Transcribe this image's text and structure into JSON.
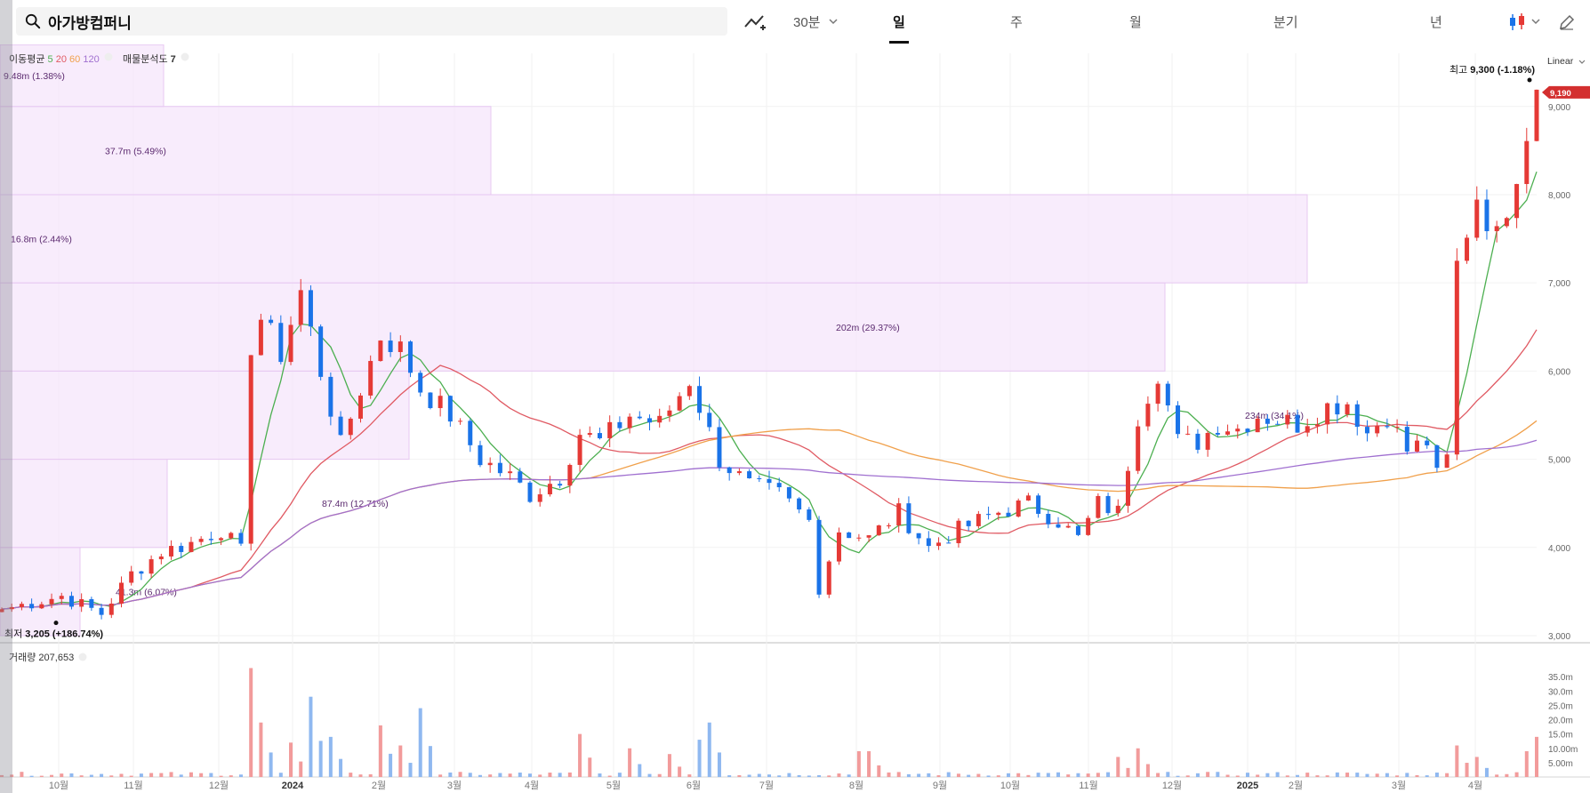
{
  "header": {
    "stock_name": "아가방컴퍼니",
    "interval": "30분",
    "tabs": [
      "일",
      "주",
      "월",
      "분기",
      "년"
    ],
    "active_tab": "일"
  },
  "indicators": {
    "ma_label": "이동평균",
    "ma_periods": [
      "5",
      "20",
      "60",
      "120"
    ],
    "ma_colors": [
      "#4caf50",
      "#e05a63",
      "#f0a04b",
      "#a070d0"
    ],
    "profile_label": "매물분석도",
    "profile_value": "7",
    "scale_label": "Linear",
    "volume_label": "거래량",
    "volume_value": "207,653"
  },
  "chart_data": {
    "type": "candlestick",
    "x_labels": [
      "10월",
      "11월",
      "12월",
      "2024",
      "2월",
      "3월",
      "4월",
      "5월",
      "6월",
      "7월",
      "8월",
      "9월",
      "10월",
      "11월",
      "12월",
      "2025",
      "2월",
      "3월",
      "4월"
    ],
    "price_axis": {
      "ticks": [
        3000,
        4000,
        5000,
        6000,
        7000,
        8000,
        9000
      ],
      "ylim": [
        3000,
        9300
      ]
    },
    "volume_axis": {
      "tick_labels": [
        "5.00m",
        "10.00m",
        "15.0m",
        "20.0m",
        "25.0m",
        "30.0m",
        "35.0m"
      ],
      "ticks": [
        5,
        10,
        15,
        20,
        25,
        30,
        35
      ],
      "ylim": [
        0,
        40
      ]
    },
    "current_price": "9,190",
    "high_annotation": {
      "label": "최고",
      "value": "9,300 (-1.18%)"
    },
    "low_annotation": {
      "label": "최저",
      "value": "3,205 (+186.74%)"
    },
    "volume_profile": [
      {
        "price_low": 3000,
        "price_high": 4000,
        "label": "41.3m (6.07%)"
      },
      {
        "price_low": 4000,
        "price_high": 5000,
        "label": "87.4m (12.71%)"
      },
      {
        "price_low": 5000,
        "price_high": 6000,
        "label": "234m (34.1%)"
      },
      {
        "price_low": 6000,
        "price_high": 7000,
        "label": "202m (29.37%)"
      },
      {
        "price_low": 7000,
        "price_high": 8000,
        "label": "16.8m (2.44%)"
      },
      {
        "price_low": 8000,
        "price_high": 9000,
        "label": "37.7m (5.49%)"
      },
      {
        "price_low": 9000,
        "price_high": 10000,
        "label": "9.48m (1.38%)"
      }
    ],
    "price_path": [
      [
        0,
        3300
      ],
      [
        6,
        3450
      ],
      [
        10,
        3250
      ],
      [
        13,
        3700
      ],
      [
        16,
        3950
      ],
      [
        19,
        4050
      ],
      [
        22,
        4200
      ],
      [
        24,
        3950
      ],
      [
        25,
        6300
      ],
      [
        26,
        6600
      ],
      [
        28,
        6200
      ],
      [
        30,
        6900
      ],
      [
        32,
        6000
      ],
      [
        34,
        5150
      ],
      [
        36,
        5800
      ],
      [
        38,
        6400
      ],
      [
        40,
        6250
      ],
      [
        42,
        5800
      ],
      [
        45,
        5500
      ],
      [
        48,
        5000
      ],
      [
        51,
        4800
      ],
      [
        53,
        4600
      ],
      [
        56,
        4800
      ],
      [
        58,
        5300
      ],
      [
        60,
        5200
      ],
      [
        63,
        5500
      ],
      [
        66,
        5400
      ],
      [
        69,
        5900
      ],
      [
        72,
        5000
      ],
      [
        75,
        4700
      ],
      [
        78,
        4600
      ],
      [
        81,
        4300
      ],
      [
        82,
        3550
      ],
      [
        84,
        4200
      ],
      [
        87,
        4100
      ],
      [
        90,
        4400
      ],
      [
        93,
        4000
      ],
      [
        96,
        4200
      ],
      [
        100,
        4400
      ],
      [
        103,
        4500
      ],
      [
        106,
        4300
      ],
      [
        108,
        4100
      ],
      [
        110,
        4500
      ],
      [
        112,
        4400
      ],
      [
        114,
        5500
      ],
      [
        116,
        6000
      ],
      [
        118,
        5200
      ],
      [
        120,
        5200
      ],
      [
        122,
        5400
      ],
      [
        124,
        5350
      ],
      [
        126,
        5500
      ],
      [
        128,
        5450
      ],
      [
        130,
        5400
      ],
      [
        133,
        5600
      ],
      [
        135,
        5650
      ],
      [
        137,
        5300
      ],
      [
        139,
        5500
      ],
      [
        141,
        5100
      ],
      [
        143,
        5200
      ],
      [
        144,
        4800
      ],
      [
        145,
        5000
      ],
      [
        146,
        7200
      ],
      [
        148,
        8000
      ],
      [
        150,
        7500
      ],
      [
        152,
        8300
      ],
      [
        154,
        9190
      ]
    ],
    "volume_spikes": [
      [
        25,
        38
      ],
      [
        26,
        19
      ],
      [
        29,
        12
      ],
      [
        31,
        28
      ],
      [
        33,
        14
      ],
      [
        38,
        18
      ],
      [
        40,
        11
      ],
      [
        42,
        24
      ],
      [
        58,
        15
      ],
      [
        63,
        10
      ],
      [
        67,
        8
      ],
      [
        70,
        13
      ],
      [
        71,
        19
      ],
      [
        86,
        9
      ],
      [
        87,
        9
      ],
      [
        112,
        7
      ],
      [
        114,
        10
      ],
      [
        146,
        11
      ],
      [
        148,
        7
      ],
      [
        153,
        9
      ],
      [
        154,
        14
      ]
    ],
    "moving_averages": [
      {
        "name": "5",
        "window": 5
      },
      {
        "name": "20",
        "window": 20
      },
      {
        "name": "60",
        "window": 60
      },
      {
        "name": "120",
        "window": 120
      }
    ]
  }
}
